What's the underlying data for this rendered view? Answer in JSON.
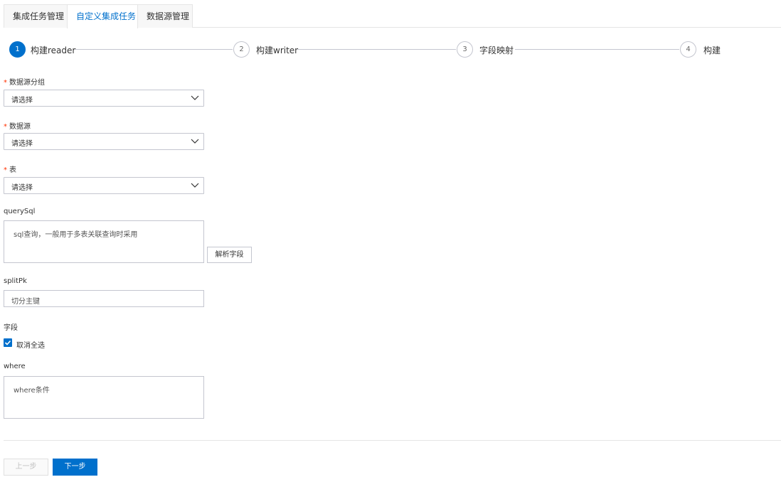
{
  "tabs": [
    {
      "label": "集成任务管理",
      "active": false
    },
    {
      "label": "自定义集成任务",
      "active": true
    },
    {
      "label": "数据源管理",
      "active": false
    }
  ],
  "steps": [
    {
      "num": "1",
      "label": "构建reader",
      "active": true
    },
    {
      "num": "2",
      "label": "构建writer",
      "active": false
    },
    {
      "num": "3",
      "label": "字段映射",
      "active": false
    },
    {
      "num": "4",
      "label": "构建",
      "active": false
    }
  ],
  "form": {
    "required_mark": "*",
    "datasource_group": {
      "label": "数据源分组",
      "placeholder": "请选择"
    },
    "datasource": {
      "label": "数据源",
      "placeholder": "请选择"
    },
    "table": {
      "label": "表",
      "placeholder": "请选择"
    },
    "query_sql": {
      "label": "querySql",
      "placeholder": "sql查询，一般用于多表关联查询时采用"
    },
    "parse_button": "解析字段",
    "split_pk": {
      "label": "splitPk",
      "placeholder": "切分主键"
    },
    "fields": {
      "label": "字段",
      "checkbox_label": "取消全选",
      "checked": true
    },
    "where": {
      "label": "where",
      "placeholder": "where条件"
    }
  },
  "footer": {
    "prev_label": "上一步",
    "next_label": "下一步"
  },
  "colors": {
    "accent": "#0070cc",
    "required": "#ff3000",
    "border": "#c4c6cf"
  }
}
